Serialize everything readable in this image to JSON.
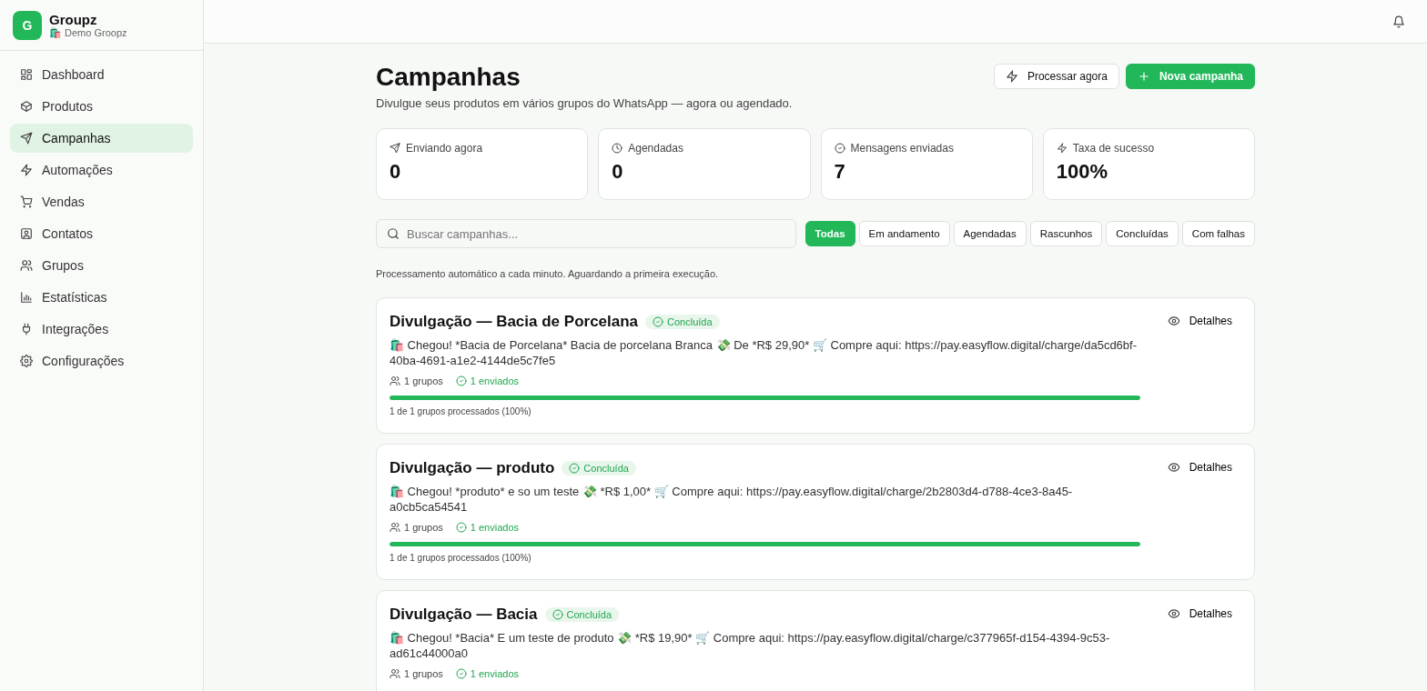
{
  "brand": {
    "logo": "G",
    "name": "Groupz",
    "workspace": "🛍️ Demo Groopz"
  },
  "sidebar": {
    "items": [
      {
        "label": "Dashboard",
        "selected": false
      },
      {
        "label": "Produtos",
        "selected": false
      },
      {
        "label": "Campanhas",
        "selected": true
      },
      {
        "label": "Automações",
        "selected": false
      },
      {
        "label": "Vendas",
        "selected": false
      },
      {
        "label": "Contatos",
        "selected": false
      },
      {
        "label": "Grupos",
        "selected": false
      },
      {
        "label": "Estatísticas",
        "selected": false
      },
      {
        "label": "Integrações",
        "selected": false
      },
      {
        "label": "Configurações",
        "selected": false
      }
    ]
  },
  "page": {
    "title": "Campanhas",
    "subtitle": "Divulgue seus produtos em vários grupos do WhatsApp — agora ou agendado.",
    "actions": [
      {
        "label": "Processar agora",
        "kind": "secondary"
      },
      {
        "label": "Nova campanha",
        "kind": "primary"
      }
    ]
  },
  "stats": [
    {
      "label": "Enviando agora",
      "value": "0"
    },
    {
      "label": "Agendadas",
      "value": "0"
    },
    {
      "label": "Mensagens enviadas",
      "value": "7"
    },
    {
      "label": "Taxa de sucesso",
      "value": "100%"
    }
  ],
  "search": {
    "placeholder": "Buscar campanhas..."
  },
  "filters": [
    {
      "label": "Todas",
      "selected": true
    },
    {
      "label": "Em andamento",
      "selected": false
    },
    {
      "label": "Agendadas",
      "selected": false
    },
    {
      "label": "Rascunhos",
      "selected": false
    },
    {
      "label": "Concluídas",
      "selected": false
    },
    {
      "label": "Com falhas",
      "selected": false
    }
  ],
  "notice": "Processamento automático a cada minuto. Aguardando a primeira execução.",
  "campaigns": [
    {
      "title": "Divulgação — Bacia de Porcelana",
      "status": "Concluída",
      "message": "🛍️ Chegou! *Bacia de Porcelana* Bacia de porcelana Branca 💸 De *R$ 29,90* 🛒 Compre aqui: https://pay.easyflow.digital/charge/da5cd6bf-40ba-4691-a1e2-4144de5c7fe5",
      "groups": "1 grupos",
      "sent": "1 enviados",
      "level": 1,
      "progress_text": "1 de 1 grupos processados (100%)",
      "details": "Detalhes"
    },
    {
      "title": "Divulgação — produto",
      "status": "Concluída",
      "message": "🛍️ Chegou! *produto* e so um teste 💸 *R$ 1,00* 🛒 Compre aqui: https://pay.easyflow.digital/charge/2b2803d4-d788-4ce3-8a45-a0cb5ca54541",
      "groups": "1 grupos",
      "sent": "1 enviados",
      "level": 1,
      "progress_text": "1 de 1 grupos processados (100%)",
      "details": "Detalhes"
    },
    {
      "title": "Divulgação — Bacia",
      "status": "Concluída",
      "message": "🛍️ Chegou! *Bacia* E um teste de produto 💸 *R$ 19,90* 🛒 Compre aqui: https://pay.easyflow.digital/charge/c377965f-d154-4394-9c53-ad61c44000a0",
      "groups": "1 grupos",
      "sent": "1 enviados",
      "details": "Detalhes"
    }
  ]
}
